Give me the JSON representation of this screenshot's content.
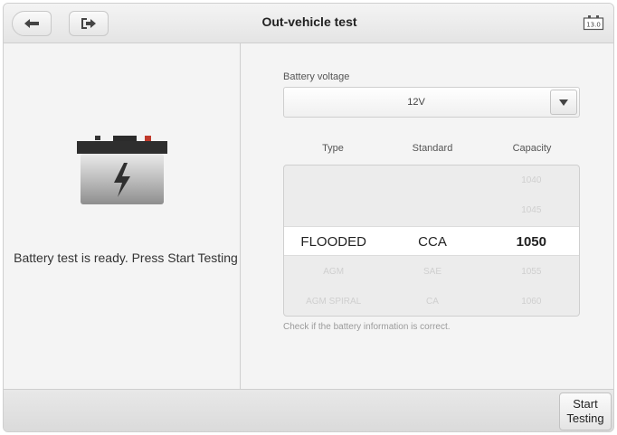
{
  "header": {
    "title": "Out-vehicle test",
    "back_icon": "arrow-left-icon",
    "exit_icon": "exit-icon",
    "battery_indicator": "13.0"
  },
  "left": {
    "battery_icon": "car-battery-icon",
    "status_message": "Battery test is ready. Press Start Testing"
  },
  "voltage": {
    "label": "Battery voltage",
    "value": "12V"
  },
  "table": {
    "headers": [
      "Type",
      "Standard",
      "Capacity"
    ],
    "rows": [
      [
        "",
        "",
        "1040"
      ],
      [
        "",
        "",
        "1045"
      ],
      [
        "FLOODED",
        "CCA",
        "1050"
      ],
      [
        "AGM",
        "SAE",
        "1055"
      ],
      [
        "AGM SPIRAL",
        "CA",
        "1060"
      ]
    ]
  },
  "hint": "Check if the battery information is correct.",
  "footer": {
    "start_line1": "Start",
    "start_line2": "Testing"
  }
}
